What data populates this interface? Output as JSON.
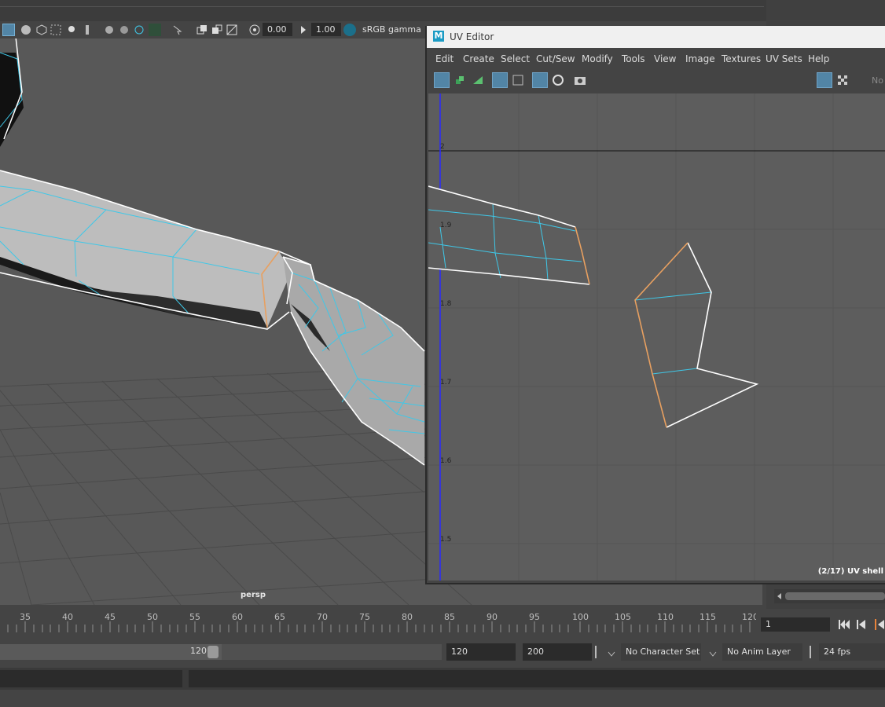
{
  "viewport": {
    "camera_label": "persp",
    "toolbar": {
      "exposure_value": "0.00",
      "gamma_value": "1.00",
      "color_space_label": "sRGB gamma",
      "icons": [
        "isolate-icon",
        "shaded-icon",
        "wireframe-icon",
        "textured-icon",
        "light-icon",
        "shadow-icon",
        "ao-icon",
        "aa-icon",
        "select-icon",
        "resolution-gate-icon",
        "grid-icon",
        "exposure-icon",
        "gamma-icon",
        "color-management-icon"
      ]
    }
  },
  "uv_editor": {
    "title": "UV Editor",
    "logo_letter": "M",
    "menu": [
      "Edit",
      "Create",
      "Select",
      "Cut/Sew",
      "Modify",
      "Tools",
      "View",
      "Image",
      "Textures",
      "UV Sets",
      "Help"
    ],
    "toolbar_icons": [
      "uv-shell-select-icon",
      "uv-select-icon",
      "uv-face-icon",
      "shaded-uv-icon",
      "wireframe-uv-icon",
      "grid-toggle-icon",
      "distortion-icon",
      "snapshot-icon",
      "image-display-icon",
      "checker-icon"
    ],
    "right_toolbar_text": "No",
    "v_axis_labels": [
      "2",
      "1.9",
      "1.8",
      "1.7",
      "1.6",
      "1.5"
    ],
    "status_text": "(2/17) UV shell"
  },
  "timeline": {
    "ticks": [
      "35",
      "40",
      "45",
      "50",
      "55",
      "60",
      "65",
      "70",
      "75",
      "80",
      "85",
      "90",
      "95",
      "100",
      "105",
      "110",
      "115",
      "120"
    ],
    "current_frame": "1"
  },
  "range": {
    "slider_end": "120",
    "end_frame": "120",
    "playback_end": "200",
    "character_set": "No Character Set",
    "anim_layer": "No Anim Layer",
    "fps": "24 fps"
  },
  "colors": {
    "selection_blue": "#3fc8e8",
    "edge_white": "#ffffff",
    "seam_orange": "#e8a060",
    "uv_axis": "#2a2aff"
  }
}
